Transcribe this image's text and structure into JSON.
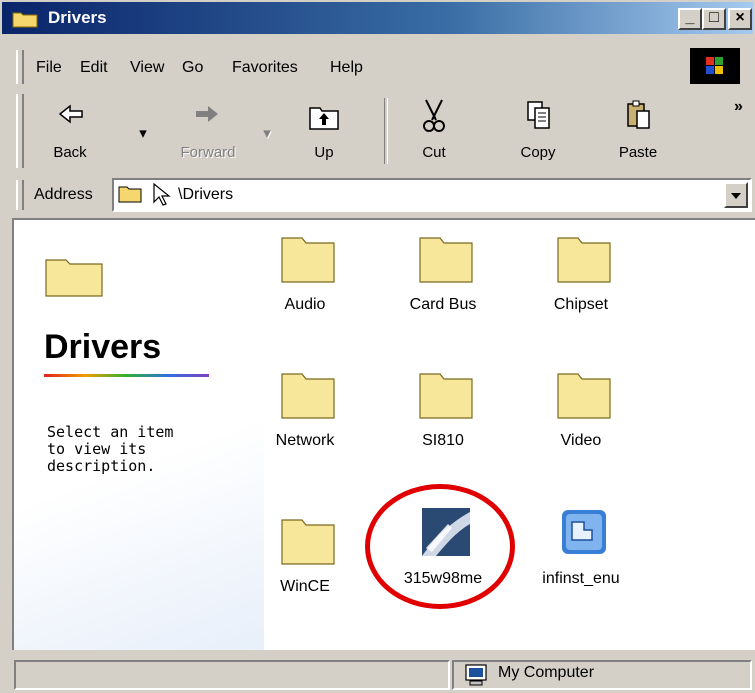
{
  "window": {
    "title": "Drivers"
  },
  "menu": [
    {
      "label": "File"
    },
    {
      "label": "Edit"
    },
    {
      "label": "View"
    },
    {
      "label": "Go"
    },
    {
      "label": "Favorites"
    },
    {
      "label": "Help"
    }
  ],
  "toolbar": {
    "back_label": "Back",
    "forward_label": "Forward",
    "up_label": "Up",
    "cut_label": "Cut",
    "copy_label": "Copy",
    "paste_label": "Paste",
    "more_label": "»"
  },
  "address": {
    "label": "Address",
    "value": "\\Drivers"
  },
  "left_pane": {
    "title": "Drivers",
    "description": "Select an item to view its description."
  },
  "items": [
    {
      "name": "Audio",
      "icon": "folder-icon"
    },
    {
      "name": "Card Bus",
      "icon": "folder-icon"
    },
    {
      "name": "Chipset",
      "icon": "folder-icon"
    },
    {
      "name": "Network",
      "icon": "folder-icon"
    },
    {
      "name": "SI810",
      "icon": "folder-icon"
    },
    {
      "name": "Video",
      "icon": "folder-icon"
    },
    {
      "name": "WinCE",
      "icon": "folder-icon"
    },
    {
      "name": "315w98me",
      "icon": "driver-exe-icon"
    },
    {
      "name": "infinst_enu",
      "icon": "installer-icon"
    }
  ],
  "statusbar": {
    "location": "My Computer"
  },
  "colors": {
    "titlebar": "#0a246a",
    "highlight_circle": "#e00000",
    "folder": "#f5e08a"
  }
}
